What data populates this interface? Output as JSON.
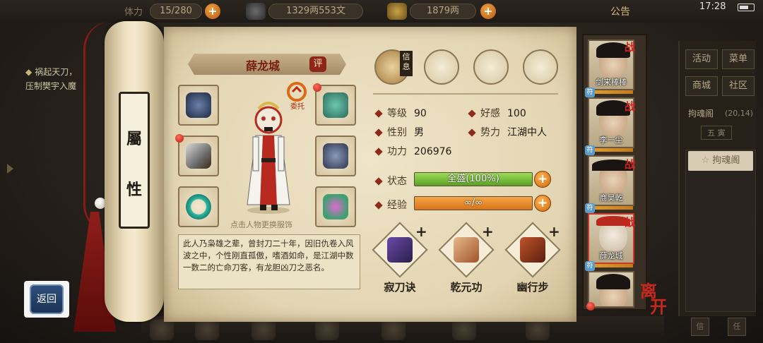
{
  "topbar": {
    "resource1": "15/280",
    "resource2": "1329两553文",
    "resource3": "1879两",
    "notice_label": "公告",
    "clock": "17:28",
    "partial_label": "体力"
  },
  "quest": {
    "line1": "祸起天刀，",
    "line2": "压制樊宇入魔"
  },
  "back_label": "返回",
  "scroll": {
    "char1": "屬",
    "char2": "性"
  },
  "character": {
    "name": "薛龙城",
    "rate_label": "评",
    "delegate_label": "委托",
    "hint": "点击人物更换服饰",
    "description": "此人乃枭雄之辈，曾封刀二十年，因旧仇卷入风波之中，个性刚直孤傲，嗜酒如命，是江湖中数一数二的亡命刀客，有龙胆凶刀之恶名。"
  },
  "tabs": {
    "selected_label": "信息",
    "icons": [
      "info-tab-icon",
      "scroll-map-tab-icon",
      "yinyang-tab-icon",
      "meridian-tab-icon"
    ]
  },
  "stats": {
    "level_label": "等级",
    "level_value": "90",
    "affinity_label": "好感",
    "affinity_value": "100",
    "gender_label": "性别",
    "gender_value": "男",
    "faction_label": "势力",
    "faction_value": "江湖中人",
    "power_label": "功力",
    "power_value": "206976",
    "status_label": "状态",
    "status_value": "全盛(100%)",
    "status_fraction": 1.0,
    "exp_label": "经验",
    "exp_value": "∞/∞",
    "exp_fraction": 1.0
  },
  "skills": [
    {
      "name": "寂刀诀",
      "icon": "blade-scroll-icon"
    },
    {
      "name": "乾元功",
      "icon": "qian-scroll-icon"
    },
    {
      "name": "幽行步",
      "icon": "book-icon"
    }
  ],
  "roster": [
    {
      "name": "剑来棒棒",
      "tag": "战"
    },
    {
      "name": "李一尘",
      "tag": "战"
    },
    {
      "name": "商昊乾",
      "tag": "战"
    },
    {
      "name": "薛龙城",
      "tag": "战"
    },
    {
      "name": "",
      "tag": ""
    }
  ],
  "roster_cert": "符",
  "leave_label_1": "离",
  "leave_label_2": "开",
  "right_panel": {
    "btn_activity": "活动",
    "btn_menu": "菜单",
    "btn_shop": "商城",
    "btn_community": "社区",
    "location": "拘魂阁",
    "coords": "(20,14)",
    "time_label": "五 寅",
    "tag_label": "拘魂阁",
    "btn_a": "信",
    "btn_b": "任"
  },
  "colors": {
    "accent_red": "#8e2a1a",
    "status_green": "#7fbf3a",
    "exp_orange": "#e58a1f",
    "parchment": "#e9dcbc"
  }
}
